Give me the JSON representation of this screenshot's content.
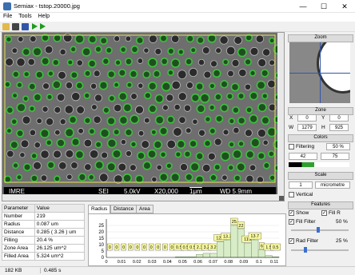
{
  "window": {
    "title": "Semiax - tstop.20000.jpg",
    "minimize": "—",
    "maximize": "☐",
    "close": "✕"
  },
  "menu": [
    "File",
    "Tools",
    "Help"
  ],
  "toolbar": {
    "icons": [
      "open-folder-icon",
      "save-icon",
      "chart-icon",
      "play-icon",
      "fast-forward-icon"
    ]
  },
  "sem_bar": {
    "left": "IMRE",
    "sei": "SEI",
    "kv": "5.0kV",
    "mag": "X20,000",
    "scale": "1μm",
    "wd": "WD 5.9mm"
  },
  "right_panel": {
    "zoom_header": "Zoom",
    "zone_header": "Zone",
    "zone": {
      "x_label": "X",
      "x": "0",
      "y_label": "Y",
      "y": "0",
      "w_label": "W",
      "w": "1279",
      "h_label": "H",
      "h": "925"
    },
    "colors_header": "Colors",
    "filtering_label": "Filtering",
    "filtering_value": "50 %",
    "color_low": "42",
    "color_high": "75",
    "scale_header": "Scale",
    "scale_value": "1",
    "scale_unit": "micrometre",
    "vertical_label": "Vertical",
    "features_header": "Features",
    "show_label": "Show",
    "fill_r_label": "Fill R",
    "fill_filter_label": "Fill Filter",
    "fill_filter_value": "50 %",
    "rad_filter_label": "Rad Filter",
    "rad_filter_value": "25 %"
  },
  "params": {
    "headers": [
      "Parameter",
      "Value"
    ],
    "rows": [
      [
        "Number",
        "219"
      ],
      [
        "Radius",
        "0.087 um"
      ],
      [
        "Distance",
        "0.285  ( 3.26 ) um"
      ],
      [
        "Filling",
        "20.4 %"
      ],
      [
        "Zone Area",
        "26.125 um^2"
      ],
      [
        "Filled Area",
        "5.324 um^2"
      ]
    ]
  },
  "tabs": [
    "Radius",
    "Distance",
    "Area"
  ],
  "chart_data": {
    "type": "bar",
    "title": "",
    "xlabel": "",
    "ylabel": "",
    "ylim": [
      0,
      30
    ],
    "yticks": [
      "0",
      "5",
      "10",
      "15",
      "20",
      "25"
    ],
    "xticks": [
      "0",
      "0.01",
      "0.02",
      "0.03",
      "0.04",
      "0.05",
      "0.06",
      "0.07",
      "0.08",
      "0.09",
      "0.1",
      "0.11"
    ],
    "x": [
      0.0,
      0.005,
      0.01,
      0.015,
      0.02,
      0.025,
      0.03,
      0.035,
      0.04,
      0.045,
      0.05,
      0.055,
      0.06,
      0.065,
      0.07,
      0.075,
      0.08,
      0.085,
      0.09,
      0.095,
      0.1,
      0.105
    ],
    "values": [
      0,
      0,
      0,
      0,
      0,
      0,
      0,
      0,
      0,
      0,
      0.5,
      0.5,
      0.5,
      2.3,
      3.2,
      3.2,
      12.3,
      13.3,
      25,
      22,
      11.2,
      13.7,
      6,
      1.5,
      0.5
    ],
    "labels": [
      "0",
      "0",
      "0",
      "0",
      "0",
      "0",
      "0",
      "0",
      "0",
      "0",
      "0.5",
      "0.5",
      "0.5",
      "2.3",
      "3.2",
      "3.2",
      "12.3",
      "13.3",
      "25",
      "22",
      "11.2",
      "13.7",
      "6",
      "1.5",
      "0.5"
    ]
  },
  "status": {
    "size": "182 KB",
    "time": "0.485 s"
  },
  "colors": {
    "accent": "#1a8a1a",
    "features_green": "#2fa02f",
    "hist_bar": "#d8ecc8",
    "label_bg": "#ffffa0"
  }
}
